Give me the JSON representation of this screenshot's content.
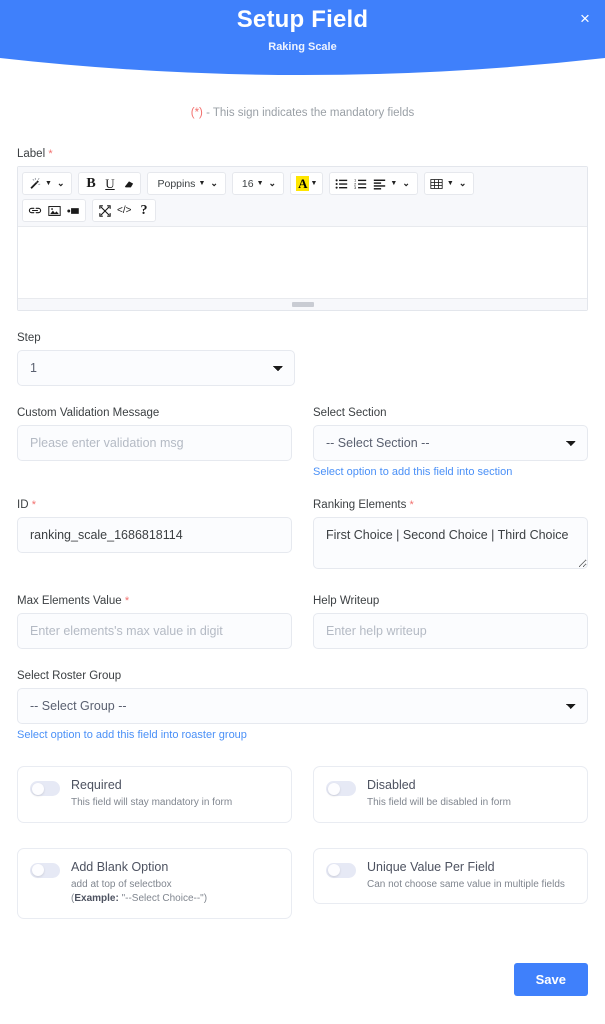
{
  "header": {
    "title": "Setup Field",
    "subtitle": "Raking Scale",
    "close_label": "×",
    "brand_color": "#3f80fb"
  },
  "mandatory_note": {
    "marker": "(*)",
    "text": " - This sign indicates the mandatory fields",
    "marker_color": "#f2706e"
  },
  "label_field": {
    "label": "Label",
    "required_marker": "*",
    "editor": {
      "content": "",
      "toolbar_row1": [
        {
          "name": "magic-wand-icon",
          "label": ""
        },
        {
          "name": "bold-icon",
          "label": "B"
        },
        {
          "name": "underline-icon",
          "label": "U"
        },
        {
          "name": "eraser-icon",
          "label": ""
        },
        {
          "name": "font-family-dropdown",
          "label": "Poppins"
        },
        {
          "name": "font-size-dropdown",
          "label": "16"
        },
        {
          "name": "text-color-icon",
          "label": "A"
        },
        {
          "name": "unordered-list-icon",
          "label": ""
        },
        {
          "name": "ordered-list-icon",
          "label": ""
        },
        {
          "name": "align-icon",
          "label": ""
        },
        {
          "name": "table-icon",
          "label": ""
        }
      ],
      "toolbar_row2": [
        {
          "name": "link-icon",
          "label": ""
        },
        {
          "name": "image-icon",
          "label": ""
        },
        {
          "name": "video-icon",
          "label": ""
        },
        {
          "name": "fullscreen-icon",
          "label": ""
        },
        {
          "name": "code-view-icon",
          "label": "</>"
        },
        {
          "name": "help-icon",
          "label": "?"
        }
      ],
      "font_family": "Poppins",
      "font_size": "16"
    }
  },
  "step": {
    "label": "Step",
    "value": "1"
  },
  "custom_validation": {
    "label": "Custom Validation Message",
    "placeholder": "Please enter validation msg",
    "value": ""
  },
  "select_section": {
    "label": "Select Section",
    "value": "-- Select Section --",
    "hint": "Select option to add this field into section"
  },
  "id_field": {
    "label": "ID",
    "required_marker": "*",
    "value": "ranking_scale_1686818114"
  },
  "ranking_elements": {
    "label": "Ranking Elements",
    "required_marker": "*",
    "value": "First Choice | Second Choice | Third Choice"
  },
  "max_elements": {
    "label": "Max Elements Value",
    "required_marker": "*",
    "placeholder": "Enter elements's max value in digit",
    "value": ""
  },
  "help_writeup": {
    "label": "Help Writeup",
    "placeholder": "Enter help writeup",
    "value": ""
  },
  "roster_group": {
    "label": "Select Roster Group",
    "value": "-- Select Group --",
    "hint": "Select option to add this field into roaster group"
  },
  "toggles": {
    "required": {
      "title": "Required",
      "desc": "This field will stay mandatory in form",
      "state": "off"
    },
    "disabled": {
      "title": "Disabled",
      "desc": "This field will be disabled in form",
      "state": "off"
    },
    "add_blank_option": {
      "title": "Add Blank Option",
      "desc_line1": "add at top of selectbox",
      "desc_example_label": "Example:",
      "desc_example_value": " \"--Select Choice--\")",
      "desc_prefix": "(",
      "state": "off"
    },
    "unique_value": {
      "title": "Unique Value Per Field",
      "desc": "Can not choose same value in multiple fields",
      "state": "off"
    }
  },
  "footer": {
    "save_label": "Save"
  }
}
